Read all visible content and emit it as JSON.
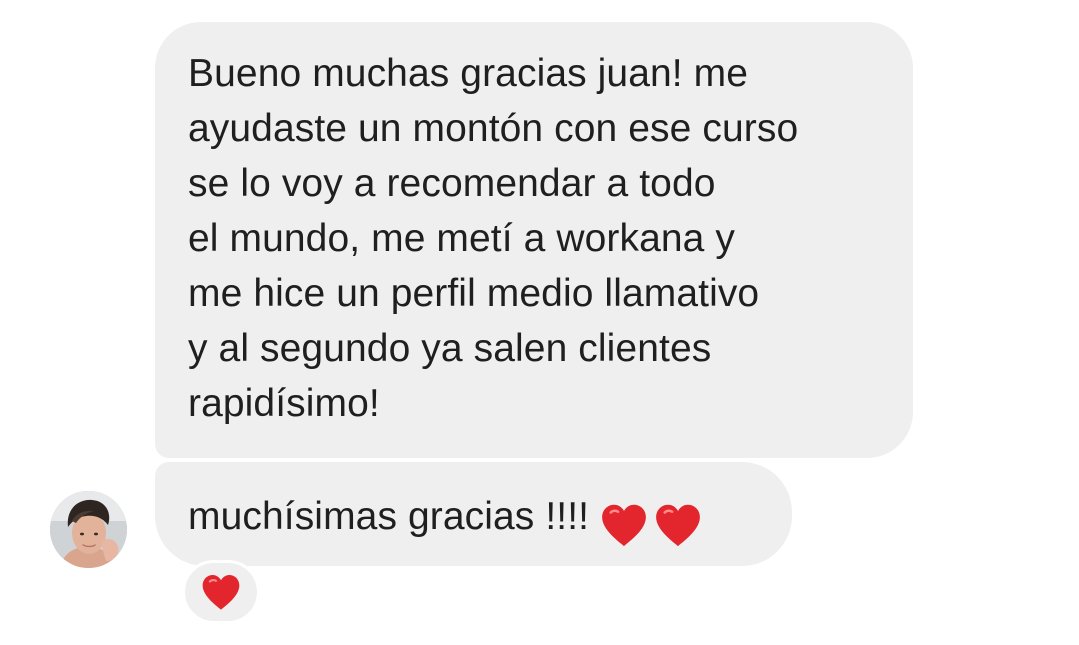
{
  "thread": {
    "messages": [
      {
        "lines": [
          "Bueno muchas gracias juan! me",
          "ayudaste un montón con ese curso",
          "se lo voy a recomendar a todo",
          "el mundo, me metí a workana y",
          "me hice un perfil medio llamativo",
          "y al segundo ya salen clientes",
          "rapidísimo!"
        ]
      },
      {
        "text": "muchísimas gracias !!!!",
        "emoji": [
          "red-heart",
          "red-heart"
        ]
      }
    ],
    "reaction": {
      "emoji": "red-heart"
    }
  },
  "colors": {
    "bubble": "#efefef",
    "text": "#1f1f1f",
    "heart": "#e3262e",
    "background": "#ffffff"
  }
}
